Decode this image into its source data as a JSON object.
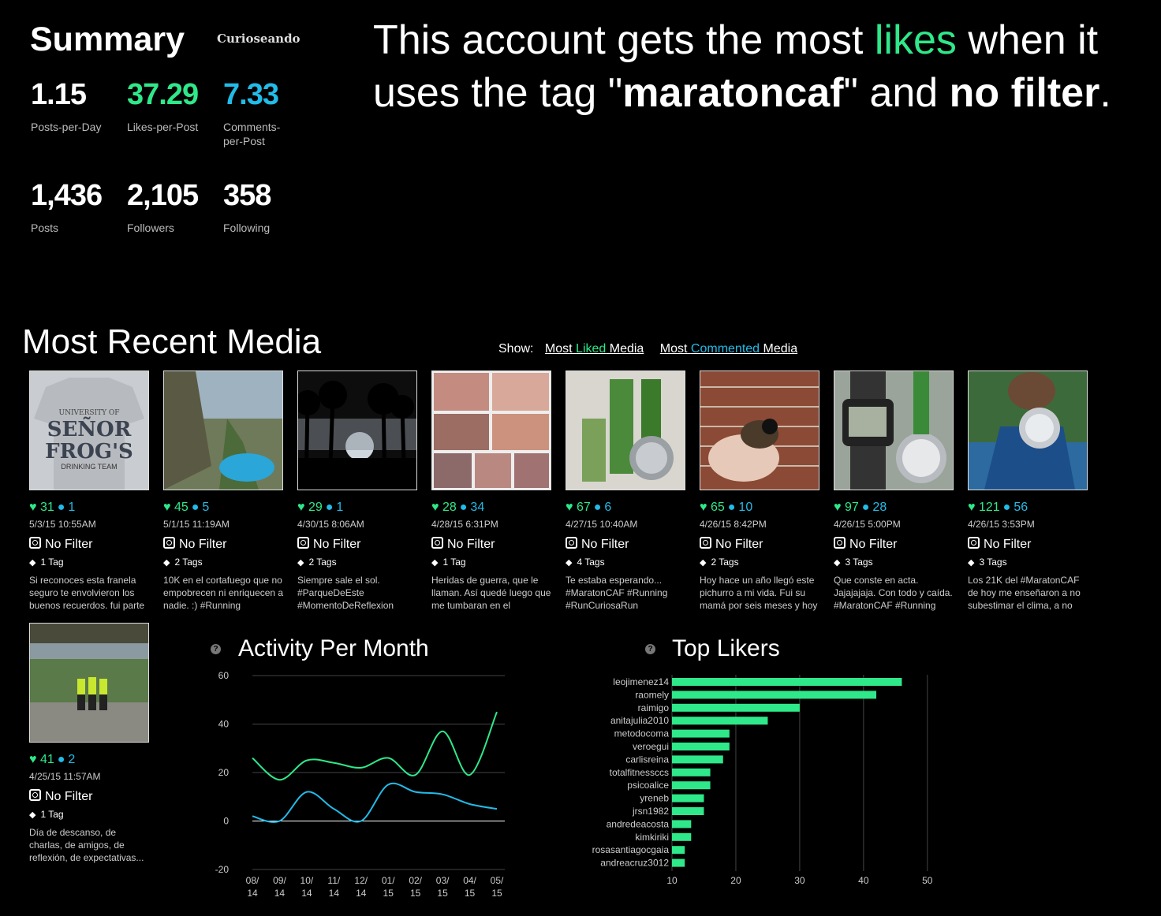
{
  "summary": {
    "title": "Summary",
    "username": "Curioseando",
    "stats": [
      {
        "value": "1.15",
        "label": "Posts-per-Day",
        "color": "#ffffff"
      },
      {
        "value": "37.29",
        "label": "Likes-per-Post",
        "color": "#2ee88a"
      },
      {
        "value": "7.33",
        "label": "Comments-per-Post",
        "color": "#22bbe8"
      },
      {
        "value": "1,436",
        "label": "Posts",
        "color": "#ffffff"
      },
      {
        "value": "2,105",
        "label": "Followers",
        "color": "#ffffff"
      },
      {
        "value": "358",
        "label": "Following",
        "color": "#ffffff"
      }
    ]
  },
  "headline": {
    "part1": "This account gets the most ",
    "likes_word": "likes",
    "part2": " when it uses the tag \"",
    "tag": "maratoncaf",
    "part3": "\" and ",
    "filter": "no filter",
    "part4": "."
  },
  "recent": {
    "title": "Most Recent Media",
    "show_label": "Show:",
    "link_liked": {
      "a": "Most ",
      "b": "Liked",
      "c": " Media"
    },
    "link_commented": {
      "a": "Most ",
      "b": "Commented",
      "c": " Media"
    }
  },
  "media": [
    {
      "likes": "31",
      "comments": "1",
      "date": "5/3/15 10:55AM",
      "filter": "No Filter",
      "tags": "1 Tag",
      "caption": "Si reconoces esta franela seguro te envolvieron los buenos recuerdos. fui parte del drinking team, pero...",
      "thumb": "shirt"
    },
    {
      "likes": "45",
      "comments": "5",
      "date": "5/1/15 11:19AM",
      "filter": "No Filter",
      "tags": "2 Tags",
      "caption": "10K en el cortafuego que no empobrecen ni enriquecen a nadie. :) #Running #RunCuriosaRun",
      "thumb": "hill"
    },
    {
      "likes": "29",
      "comments": "1",
      "date": "4/30/15 8:06AM",
      "filter": "No Filter",
      "tags": "2 Tags",
      "caption": "Siempre sale el sol. #ParqueDeEste #MomentoDeReflexion",
      "thumb": "palms"
    },
    {
      "likes": "28",
      "comments": "34",
      "date": "4/28/15 6:31PM",
      "filter": "No Filter",
      "tags": "1 Tag",
      "caption": "Heridas de guerra, que le llaman. Así quedé luego que me tumbaran en el #MaratonCAF Pero...",
      "thumb": "collage"
    },
    {
      "likes": "67",
      "comments": "6",
      "date": "4/27/15 10:40AM",
      "filter": "No Filter",
      "tags": "4 Tags",
      "caption": "Te estaba esperando... #MaratonCAF #Running #RunCuriosaRun #MeDueleTodoPeroLaSonrisa",
      "thumb": "medals"
    },
    {
      "likes": "65",
      "comments": "10",
      "date": "4/26/15 8:42PM",
      "filter": "No Filter",
      "tags": "2 Tags",
      "caption": "Hoy hace un año llegó este pichurro a mi vida. Fui su mamá por seis meses y hoy debe ser un flamante papá",
      "thumb": "bird"
    },
    {
      "likes": "97",
      "comments": "28",
      "date": "4/26/15 5:00PM",
      "filter": "No Filter",
      "tags": "3 Tags",
      "caption": "Que conste en acta. Jajajajaja. Con todo y caída. #MaratonCAF #Running #RunCuriosaRun",
      "thumb": "watch"
    },
    {
      "likes": "121",
      "comments": "56",
      "date": "4/26/15 3:53PM",
      "filter": "No Filter",
      "tags": "3 Tags",
      "caption": "Los 21K del #MaratonCAF de hoy me enseñaron a no subestimar el clima, a no dejar de pensar que algo...",
      "thumb": "runner"
    },
    {
      "likes": "41",
      "comments": "2",
      "date": "4/25/15 11:57AM",
      "filter": "No Filter",
      "tags": "1 Tag",
      "caption": "Día de descanso, de charlas, de amigos, de reflexión, de expectativas...",
      "thumb": "group"
    }
  ],
  "chart_data": [
    {
      "type": "line",
      "title": "Activity Per Month",
      "categories": [
        "08/14",
        "09/14",
        "10/14",
        "11/14",
        "12/14",
        "01/15",
        "02/15",
        "03/15",
        "04/15",
        "05/15"
      ],
      "ylim": [
        -20,
        60
      ],
      "yticks": [
        60,
        40,
        20,
        0,
        -20
      ],
      "xticks": [
        [
          "08/",
          "14"
        ],
        [
          "09/",
          "14"
        ],
        [
          "10/",
          "14"
        ],
        [
          "11/",
          "14"
        ],
        [
          "12/",
          "14"
        ],
        [
          "01/",
          "15"
        ],
        [
          "02/",
          "15"
        ],
        [
          "03/",
          "15"
        ],
        [
          "04/",
          "15"
        ],
        [
          "05/",
          "15"
        ]
      ],
      "series": [
        {
          "values": [
            26,
            17,
            25,
            24,
            22,
            26,
            19,
            37,
            19,
            45
          ],
          "color": "#2ee88a"
        },
        {
          "values": [
            2,
            0,
            12,
            5,
            0,
            15,
            12,
            11,
            7,
            5
          ],
          "color": "#22bbe8"
        }
      ]
    },
    {
      "type": "bar",
      "orientation": "horizontal",
      "title": "Top Likers",
      "categories": [
        "leojimenez14",
        "raomely",
        "raimigo",
        "anitajulia2010",
        "metodocoma",
        "veroegui",
        "carlisreina",
        "totalfitnessccs",
        "psicoalice",
        "yreneb",
        "jrsn1982",
        "andredeacosta",
        "kimkiriki",
        "rosasantiagocgaia",
        "andreacruz3012"
      ],
      "values": [
        46,
        42,
        30,
        25,
        19,
        19,
        18,
        16,
        16,
        15,
        15,
        13,
        13,
        12,
        12
      ],
      "xlim": [
        10,
        52
      ],
      "xticks": [
        10,
        20,
        30,
        40,
        50
      ],
      "color": "#2ee88a"
    }
  ]
}
